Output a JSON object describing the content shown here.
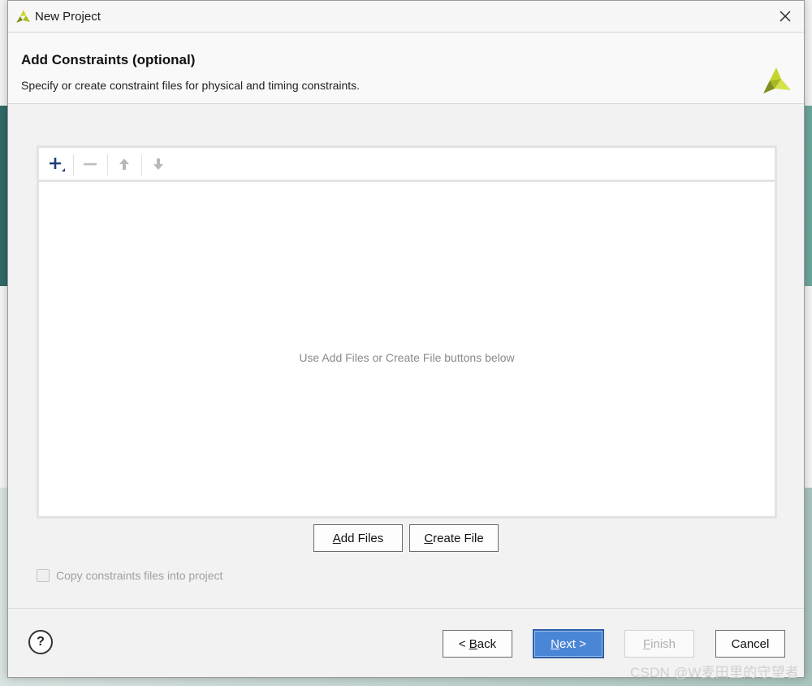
{
  "window": {
    "title": "New Project",
    "close_icon": "close-icon"
  },
  "header": {
    "title": "Add Constraints (optional)",
    "subtitle": "Specify or create constraint files for physical and timing constraints.",
    "logo": "vivado-logo-icon"
  },
  "toolbar": {
    "add_icon": "plus-icon",
    "remove_icon": "minus-icon",
    "move_up_icon": "arrow-up-icon",
    "move_down_icon": "arrow-down-icon"
  },
  "file_list": {
    "empty_message": "Use Add Files or Create File buttons below",
    "items": []
  },
  "actions": {
    "add_files_mnemonic": "A",
    "add_files_rest": "dd Files",
    "create_file_mnemonic": "C",
    "create_file_rest": "reate File"
  },
  "options": {
    "copy_constraints_label": "Copy constraints files into project",
    "copy_constraints_checked": false
  },
  "footer": {
    "help_label": "?",
    "back_prefix": "< ",
    "back_mnemonic": "B",
    "back_rest": "ack",
    "next_mnemonic": "N",
    "next_rest": "ext >",
    "finish_mnemonic": "F",
    "finish_rest": "inish",
    "cancel_label": "Cancel"
  },
  "watermark": "CSDN @W麦田里的守望者",
  "colors": {
    "primary_button": "#4a86d6",
    "logo_yellow": "#c8d62b",
    "logo_olive": "#7f8f1d"
  }
}
